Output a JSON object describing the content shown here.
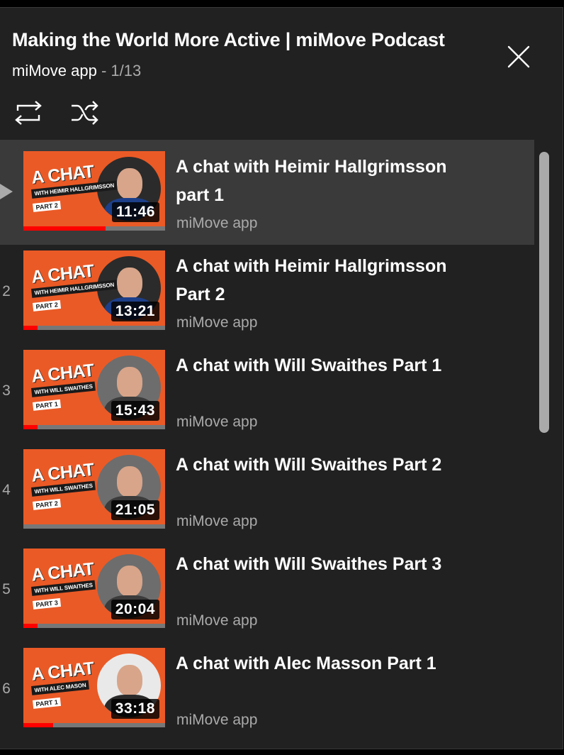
{
  "playlist": {
    "title": "Making the World More Active | miMove Podcast",
    "channel": "miMove app",
    "position": " - 1/13"
  },
  "controls": {
    "close_icon": "close-icon",
    "loop_icon": "loop-icon",
    "shuffle_icon": "shuffle-icon"
  },
  "colors": {
    "panel_bg": "#212121",
    "active_bg": "#3a3a3a",
    "thumbnail_bg": "#ea5a26",
    "progress_red": "#ff0000",
    "secondary_text": "#aaaaaa"
  },
  "items": [
    {
      "index": "",
      "active": true,
      "title": "A chat with Heimir Hallgrimsson part 1",
      "channel": "miMove app",
      "duration": "11:46",
      "progress": 0.58,
      "thumb": {
        "chat": "A CHAT",
        "with": "WITH HEIMIR HALLGRIMSSON",
        "part": "PART 2",
        "shirt": "#1d3f8a",
        "bg": "#2b2b2b"
      }
    },
    {
      "index": "2",
      "active": false,
      "title": "A chat with Heimir Hallgrimsson Part 2",
      "channel": "miMove app",
      "duration": "13:21",
      "progress": 0.1,
      "thumb": {
        "chat": "A CHAT",
        "with": "WITH HEIMIR HALLGRIMSSON",
        "part": "PART 2",
        "shirt": "#1d3f8a",
        "bg": "#2b2b2b"
      }
    },
    {
      "index": "3",
      "active": false,
      "title": "A chat with Will Swaithes Part 1",
      "channel": "miMove app",
      "duration": "15:43",
      "progress": 0.1,
      "thumb": {
        "chat": "A CHAT",
        "with": "WITH WILL SWAITHES",
        "part": "PART 1",
        "shirt": "#3b3b3b",
        "bg": "#6d6d6d"
      }
    },
    {
      "index": "4",
      "active": false,
      "title": "A chat with Will Swaithes Part 2",
      "channel": "miMove app",
      "duration": "21:05",
      "progress": 0,
      "thumb": {
        "chat": "A CHAT",
        "with": "WITH WILL SWAITHES",
        "part": "PART 2",
        "shirt": "#3b3b3b",
        "bg": "#6d6d6d"
      }
    },
    {
      "index": "5",
      "active": false,
      "title": "A chat with Will Swaithes Part 3",
      "channel": "miMove app",
      "duration": "20:04",
      "progress": 0.1,
      "thumb": {
        "chat": "A CHAT",
        "with": "WITH WILL SWAITHES",
        "part": "PART 3",
        "shirt": "#3b3b3b",
        "bg": "#6d6d6d"
      }
    },
    {
      "index": "6",
      "active": false,
      "title": "A chat with Alec Masson Part 1",
      "channel": "miMove app",
      "duration": "33:18",
      "progress": 0.21,
      "thumb": {
        "chat": "A CHAT",
        "with": "WITH ALEC MASON",
        "part": "PART 1",
        "shirt": "#2a2a2a",
        "bg": "#e9e9e9"
      }
    }
  ]
}
